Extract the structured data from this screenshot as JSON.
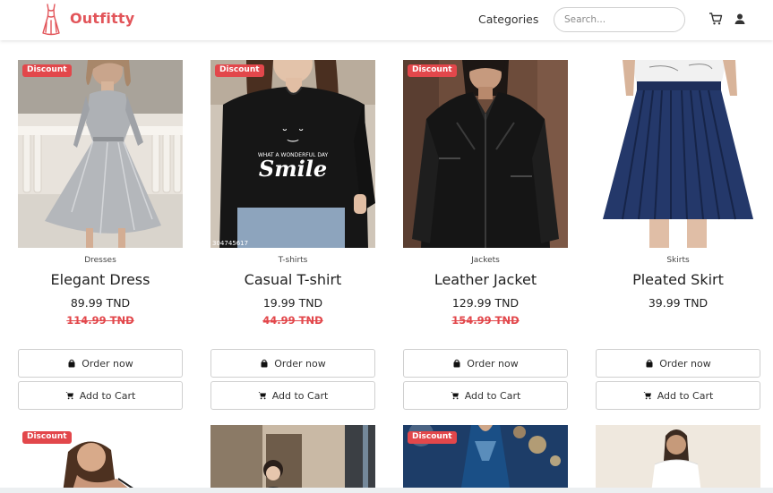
{
  "header": {
    "brand": "Outfitty",
    "nav_categories": "Categories",
    "search_placeholder": "Search...",
    "icons": [
      "dress-logo-icon",
      "cart-icon",
      "user-icon"
    ],
    "accent": "#e2555a"
  },
  "products": [
    {
      "badge": "Discount",
      "category": "Dresses",
      "name": "Elegant Dress",
      "price": "89.99 TND",
      "old_price": "114.99 TND"
    },
    {
      "badge": "Discount",
      "category": "T-shirts",
      "name": "Casual T-shirt",
      "price": "19.99 TND",
      "old_price": "44.99 TND",
      "shirt_print": {
        "line1": "WHAT A WONDERFUL DAY",
        "line2": "Smile",
        "tag": "304745617"
      }
    },
    {
      "badge": "Discount",
      "category": "Jackets",
      "name": "Leather Jacket",
      "price": "129.99 TND",
      "old_price": "154.99 TND"
    },
    {
      "category": "Skirts",
      "name": "Pleated Skirt",
      "price": "39.99 TND"
    }
  ],
  "buttons": {
    "order": "Order now",
    "cart": "Add to Cart"
  },
  "second_row_badges": [
    "Discount",
    "Discount"
  ],
  "colors": {
    "discount": "#e2474b",
    "text": "#222222",
    "border": "#cfcfcf"
  }
}
